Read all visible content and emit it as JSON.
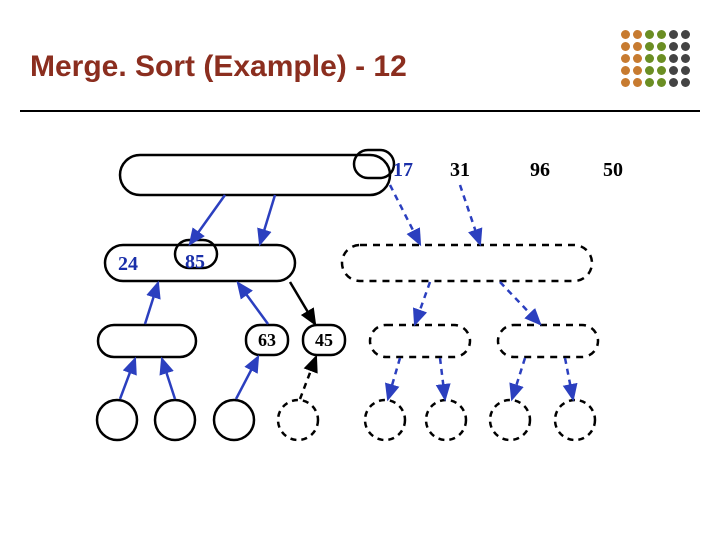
{
  "title": "Merge. Sort (Example) - 12",
  "values": {
    "v17": "17",
    "v31": "31",
    "v96": "96",
    "v50": "50",
    "v24": "24",
    "v85": "85",
    "v63": "63",
    "v45": "45"
  }
}
